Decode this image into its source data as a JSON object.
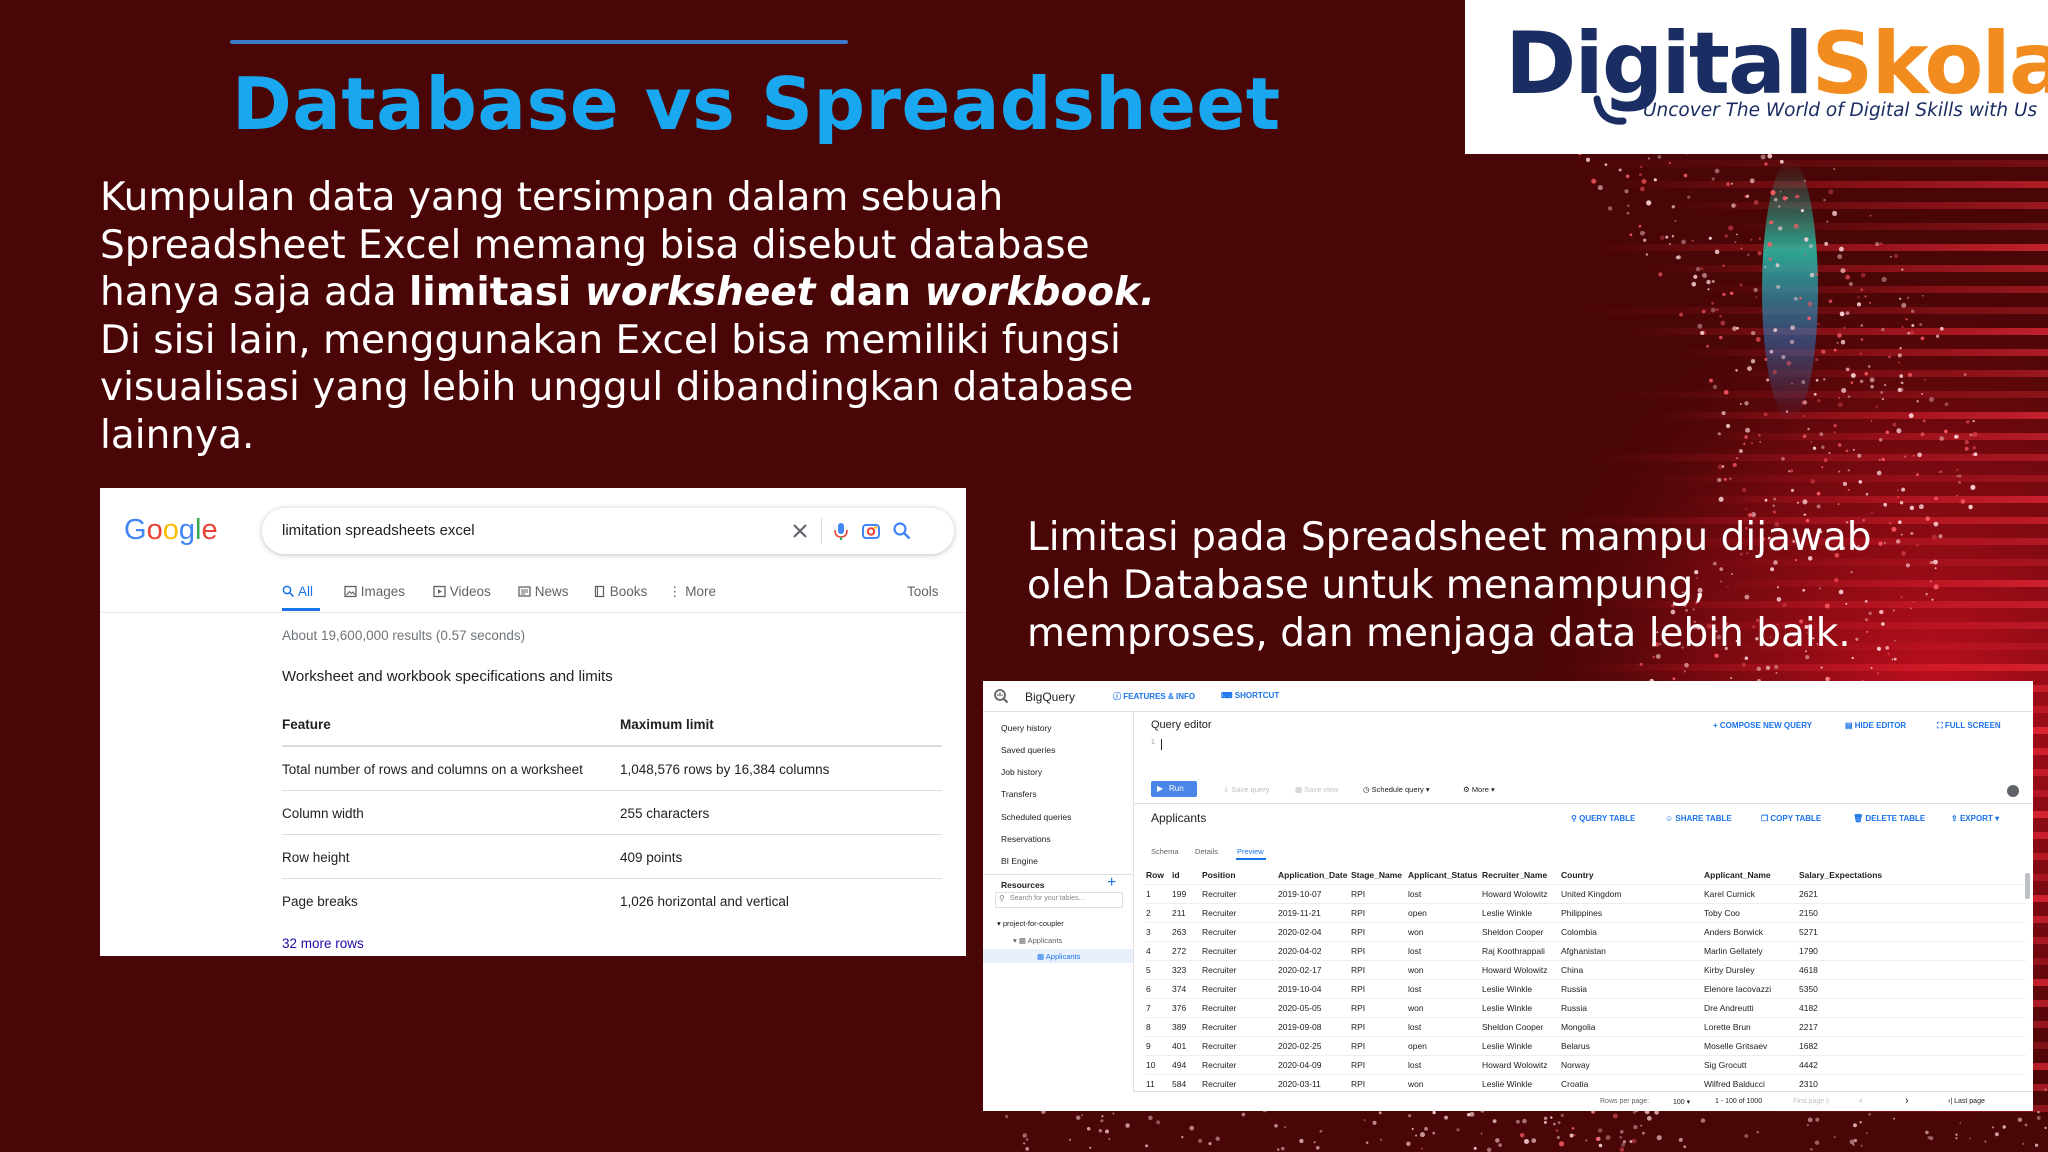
{
  "slide": {
    "title": "Database vs Spreadsheet",
    "paragraph1": {
      "line1": "Kumpulan data yang tersimpan dalam sebuah",
      "line2": "Spreadsheet Excel memang bisa disebut database",
      "line3_prefix": "hanya saja ada ",
      "line3_bold1": "limitasi ",
      "line3_bolditalic1": "worksheet",
      "line3_bold2": " dan ",
      "line3_bolditalic2": "workbook.",
      "line4": "Di sisi lain, menggunakan Excel bisa memiliki fungsi",
      "line5": "visualisasi yang lebih unggul dibandingkan database",
      "line6": "lainnya."
    },
    "paragraph2": {
      "line1": "Limitasi pada Spreadsheet mampu dijawab",
      "line2": "oleh Database untuk menampung,",
      "line3": "memproses, dan menjaga data lebih baik."
    }
  },
  "logo": {
    "word_part1": "Digital",
    "word_part2": "Skola",
    "tagline": "Uncover The World of Digital Skills with Us",
    "colors": {
      "navy": "#1b2e63",
      "orange": "#f28c1e"
    }
  },
  "google": {
    "logo_text": "Google",
    "query": "limitation spreadsheets excel",
    "tabs": {
      "all": "All",
      "images": "Images",
      "videos": "Videos",
      "news": "News",
      "books": "Books",
      "more": "More",
      "tools": "Tools"
    },
    "stats": "About 19,600,000 results (0.57 seconds)",
    "heading": "Worksheet and workbook specifications and limits",
    "table": {
      "headers": [
        "Feature",
        "Maximum limit"
      ],
      "rows": [
        [
          "Total number of rows and columns on a worksheet",
          "1,048,576 rows by 16,384 columns"
        ],
        [
          "Column width",
          "255 characters"
        ],
        [
          "Row height",
          "409 points"
        ],
        [
          "Page breaks",
          "1,026 horizontal and vertical"
        ]
      ]
    },
    "more_rows": "32 more rows"
  },
  "bigquery": {
    "app_title": "BigQuery",
    "features_info": "FEATURES & INFO",
    "shortcut": "SHORTCUT",
    "sidebar": [
      "Query history",
      "Saved queries",
      "Job history",
      "Transfers",
      "Scheduled queries",
      "Reservations",
      "BI Engine"
    ],
    "resources": "Resources",
    "search_placeholder": "Search for your tables...",
    "tree": {
      "project": "project-for-coupler",
      "dataset": "Applicants",
      "table": "Applicants"
    },
    "editor_title": "Query editor",
    "line_number": "1",
    "compose": "COMPOSE NEW QUERY",
    "hide_editor": "HIDE EDITOR",
    "full_screen": "FULL SCREEN",
    "toolbar": {
      "run": "Run",
      "save_query": "Save query",
      "save_view": "Save view",
      "schedule": "Schedule query",
      "more": "More"
    },
    "table_name": "Applicants",
    "actions": {
      "query_table": "QUERY TABLE",
      "share_table": "SHARE TABLE",
      "copy_table": "COPY TABLE",
      "delete_table": "DELETE TABLE",
      "export": "EXPORT"
    },
    "subtabs": {
      "schema": "Schema",
      "details": "Details",
      "preview": "Preview"
    },
    "columns": [
      "Row",
      "id",
      "Position",
      "Application_Date",
      "Stage_Name",
      "Applicant_Status",
      "Recruiter_Name",
      "Country",
      "Applicant_Name",
      "Salary_Expectations"
    ],
    "rows": [
      [
        "1",
        "199",
        "Recruiter",
        "2019-10-07",
        "RPI",
        "lost",
        "Howard Wolowitz",
        "United Kingdom",
        "Karel Curnick",
        "2621"
      ],
      [
        "2",
        "211",
        "Recruiter",
        "2019-11-21",
        "RPI",
        "open",
        "Leslie Winkle",
        "Philippines",
        "Toby Coo",
        "2150"
      ],
      [
        "3",
        "263",
        "Recruiter",
        "2020-02-04",
        "RPI",
        "won",
        "Sheldon Cooper",
        "Colombia",
        "Anders Borwick",
        "5271"
      ],
      [
        "4",
        "272",
        "Recruiter",
        "2020-04-02",
        "RPI",
        "lost",
        "Raj Koothrappali",
        "Afghanistan",
        "Marlin Gellately",
        "1790"
      ],
      [
        "5",
        "323",
        "Recruiter",
        "2020-02-17",
        "RPI",
        "won",
        "Howard Wolowitz",
        "China",
        "Kirby Dursley",
        "4618"
      ],
      [
        "6",
        "374",
        "Recruiter",
        "2019-10-04",
        "RPI",
        "lost",
        "Leslie Winkle",
        "Russia",
        "Elenore Iacovazzi",
        "5350"
      ],
      [
        "7",
        "376",
        "Recruiter",
        "2020-05-05",
        "RPI",
        "won",
        "Leslie Winkle",
        "Russia",
        "Dre Andreutti",
        "4182"
      ],
      [
        "8",
        "389",
        "Recruiter",
        "2019-09-08",
        "RPI",
        "lost",
        "Sheldon Cooper",
        "Mongolia",
        "Lorette Brun",
        "2217"
      ],
      [
        "9",
        "401",
        "Recruiter",
        "2020-02-25",
        "RPI",
        "open",
        "Leslie Winkle",
        "Belarus",
        "Moselle Gritsaev",
        "1682"
      ],
      [
        "10",
        "494",
        "Recruiter",
        "2020-04-09",
        "RPI",
        "lost",
        "Howard Wolowitz",
        "Norway",
        "Sig Grocutt",
        "4442"
      ],
      [
        "11",
        "584",
        "Recruiter",
        "2020-03-11",
        "RPI",
        "won",
        "Leslie Winkle",
        "Croatia",
        "Wilfred Balducci",
        "2310"
      ]
    ],
    "footer": {
      "rows_per_page": "Rows per page:",
      "page_size": "100",
      "range": "1 - 100 of 1000",
      "first_page": "First page",
      "last_page": "Last page"
    }
  },
  "colors": {
    "background": "#4a0606",
    "title_blue": "#19a7f0",
    "rule_blue": "#3a78c9"
  }
}
